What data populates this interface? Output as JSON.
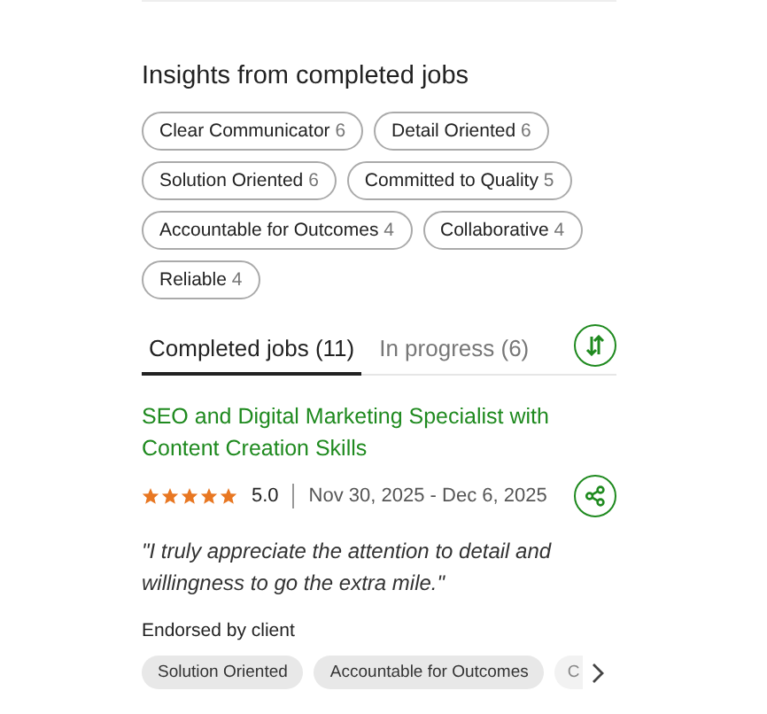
{
  "insights": {
    "title": "Insights from completed jobs",
    "chips": [
      {
        "label": "Clear Communicator",
        "count": "6"
      },
      {
        "label": "Detail Oriented",
        "count": "6"
      },
      {
        "label": "Solution Oriented",
        "count": "6"
      },
      {
        "label": "Committed to Quality",
        "count": "5"
      },
      {
        "label": "Accountable for Outcomes",
        "count": "4"
      },
      {
        "label": "Collaborative",
        "count": "4"
      },
      {
        "label": "Reliable",
        "count": "4"
      }
    ]
  },
  "tabs": [
    {
      "label": "Completed jobs (11)",
      "selected": true
    },
    {
      "label": "In progress (6)",
      "selected": false
    }
  ],
  "job": {
    "title": "SEO and Digital Marketing Specialist with Content Creation Skills",
    "stars": 5,
    "rating": "5.0",
    "dates": "Nov 30, 2025 - Dec 6, 2025",
    "quote": "\"I truly appreciate the attention to detail and willingness to go the extra mile.\"",
    "endorsed_label": "Endorsed by client",
    "endorsements": [
      "Solution Oriented",
      "Accountable for Outcomes",
      "C"
    ]
  }
}
